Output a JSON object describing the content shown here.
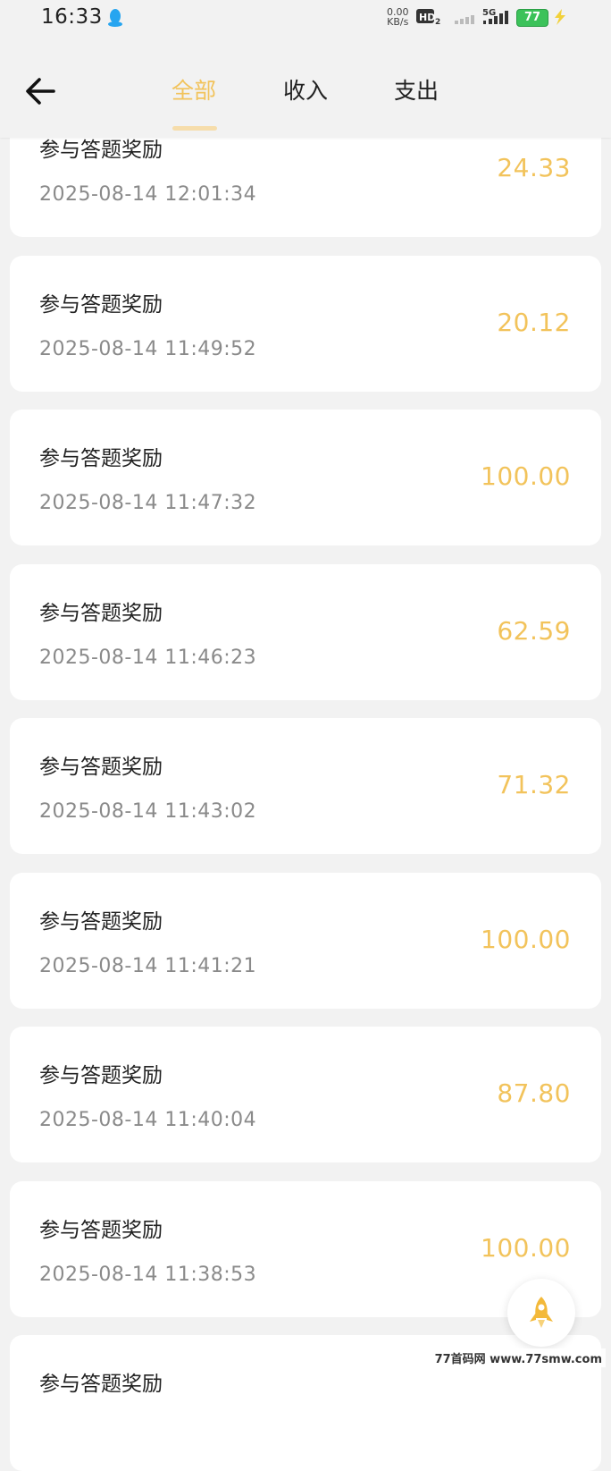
{
  "status_bar": {
    "time": "16:33",
    "net_speed_value": "0.00",
    "net_speed_unit": "KB/s",
    "network": "5G",
    "battery": "77",
    "icons": [
      "qq-icon",
      "hd-icon",
      "signal-icon",
      "battery-icon",
      "charging-icon"
    ]
  },
  "header": {
    "tabs": [
      {
        "label": "全部",
        "active": true
      },
      {
        "label": "收入",
        "active": false
      },
      {
        "label": "支出",
        "active": false
      }
    ],
    "accent_color": "#f2c35b"
  },
  "records": [
    {
      "title": "参与答题奖励",
      "date": "2025-08-14 12:01:34",
      "amount": "24.33"
    },
    {
      "title": "参与答题奖励",
      "date": "2025-08-14 11:49:52",
      "amount": "20.12"
    },
    {
      "title": "参与答题奖励",
      "date": "2025-08-14 11:47:32",
      "amount": "100.00"
    },
    {
      "title": "参与答题奖励",
      "date": "2025-08-14 11:46:23",
      "amount": "62.59"
    },
    {
      "title": "参与答题奖励",
      "date": "2025-08-14 11:43:02",
      "amount": "71.32"
    },
    {
      "title": "参与答题奖励",
      "date": "2025-08-14 11:41:21",
      "amount": "100.00"
    },
    {
      "title": "参与答题奖励",
      "date": "2025-08-14 11:40:04",
      "amount": "87.80"
    },
    {
      "title": "参与答题奖励",
      "date": "2025-08-14 11:38:53",
      "amount": "100.00"
    },
    {
      "title": "参与答题奖励",
      "date": "",
      "amount": ""
    }
  ],
  "watermark": "77首码网 www.77smw.com"
}
